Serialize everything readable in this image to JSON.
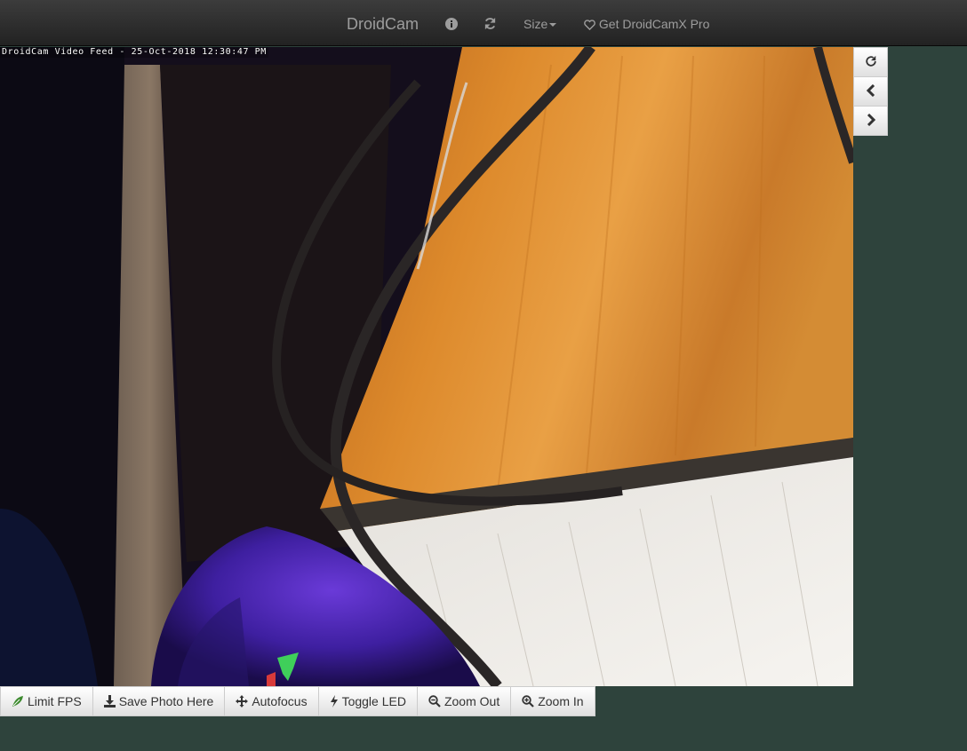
{
  "navbar": {
    "brand": "DroidCam",
    "info_icon": "info-sign-icon",
    "refresh_icon": "refresh-icon",
    "size_label": "Size",
    "pro_label": "Get DroidCamX Pro",
    "pro_icon": "heart-outline-icon"
  },
  "video": {
    "overlay_text": "DroidCam Video Feed - 25-Oct-2018 12:30:47 PM"
  },
  "side_controls": [
    {
      "icon": "rotate-icon"
    },
    {
      "icon": "chevron-left-icon"
    },
    {
      "icon": "chevron-right-icon"
    }
  ],
  "toolbar": {
    "limit_fps": "Limit FPS",
    "save_photo": "Save Photo Here",
    "autofocus": "Autofocus",
    "toggle_led": "Toggle LED",
    "zoom_out": "Zoom Out",
    "zoom_in": "Zoom In"
  },
  "colors": {
    "background": "#2e433c",
    "navbar": "#222222",
    "nav_text": "#9d9d9d",
    "button_text": "#333333",
    "leaf_icon": "#3c8a2e"
  }
}
